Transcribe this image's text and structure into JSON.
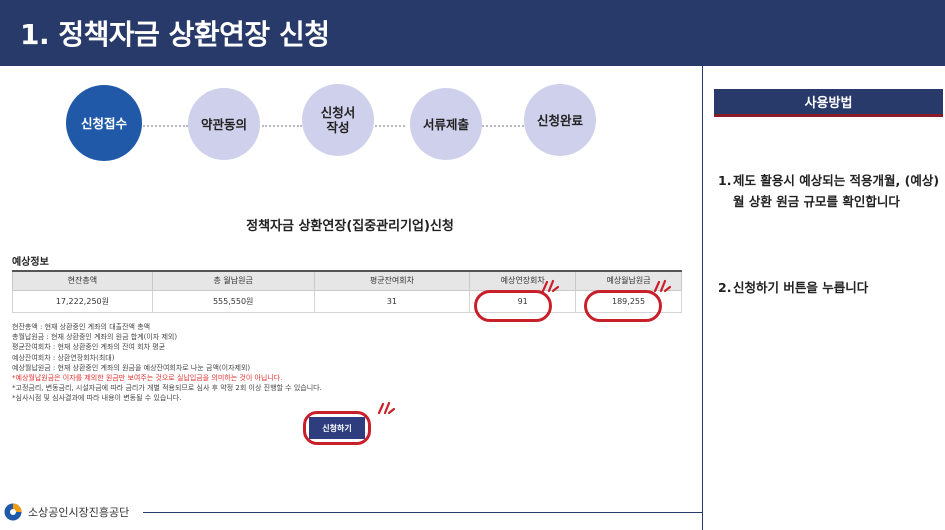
{
  "header": {
    "title": "1. 정책자금 상환연장 신청"
  },
  "steps": [
    {
      "label": "신청접수",
      "active": true
    },
    {
      "label": "약관동의",
      "active": false
    },
    {
      "label": "신청서\n작성",
      "active": false
    },
    {
      "label": "서류제출",
      "active": false
    },
    {
      "label": "신청완료",
      "active": false
    }
  ],
  "form": {
    "title": "정책자금 상환연장(집중관리기업)신청",
    "section_label": "예상정보",
    "table": {
      "headers": [
        "현잔총액",
        "총 월납원금",
        "평균잔여회차",
        "예상연장회차",
        "예상월납원금"
      ],
      "row": [
        "17,222,250원",
        "555,550원",
        "31",
        "91",
        "189,255"
      ]
    },
    "notes": [
      "현잔총액 : 현재 상환중인 계좌의 대출잔액 총액",
      "총월납원금 : 현재 상환중인 계좌의 원금 합계(이자 제외)",
      "평균잔여회차 : 현재 상환중인 계좌의 잔여 회차 평균",
      "예상잔여회차 : 상환연장회차(최대)",
      "예상월납원금 : 현재 상환중인 계좌의 원금을 예상잔여회차로 나눈 금액(이자제외)",
      "*예상월납원금은 이자를 제외한 원금만 보여주는 것으로 실납입금을 의미하는 것이 아닙니다.",
      "*고정금리, 변동금리, 시설자금에 따라 금리가 개별 적용되므로 심사 후 약정 2회 이상 진행할 수 있습니다.",
      "*심사시점 및 심사결과에 따라 내용이 변동될 수 있습니다."
    ],
    "apply_button": "신청하기"
  },
  "guide": {
    "heading": "사용방법",
    "items": [
      {
        "num": "1.",
        "text": "제도 활용시 예상되는 적용개월, (예상)월 상환 원금 규모를 확인합니다"
      },
      {
        "num": "2.",
        "text": "신청하기 버튼을 누릅니다"
      }
    ]
  },
  "footer": {
    "org": "소상공인시장진흥공단"
  },
  "colors": {
    "navy": "#283a6a",
    "active_step": "#1f59a7",
    "inactive_step": "#cfd0ec",
    "highlight": "#c8202a"
  }
}
